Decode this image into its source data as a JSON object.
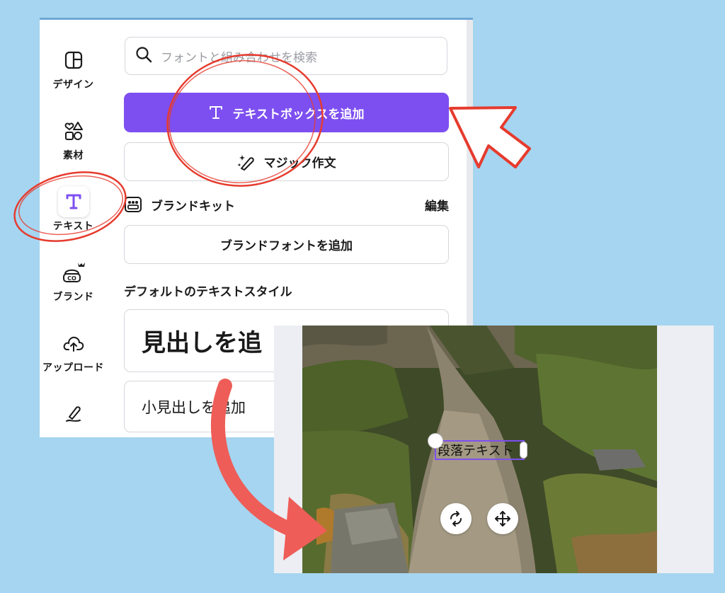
{
  "sidebar": {
    "items": [
      {
        "label": "デザイン",
        "icon": "layout-icon"
      },
      {
        "label": "素材",
        "icon": "shapes-icon"
      },
      {
        "label": "テキスト",
        "icon": "text-icon",
        "active": true
      },
      {
        "label": "ブランド",
        "icon": "brand-icon"
      },
      {
        "label": "アップロード",
        "icon": "upload-icon"
      },
      {
        "label": "",
        "icon": "draw-icon"
      }
    ]
  },
  "search": {
    "placeholder": "フォントと組み合わせを検索"
  },
  "buttons": {
    "add_textbox": "テキストボックスを追加",
    "magic_write": "マジック作文",
    "add_brand_font": "ブランドフォントを追加"
  },
  "brand_kit": {
    "title": "ブランドキット",
    "edit": "編集"
  },
  "default_styles": {
    "title": "デフォルトのテキストスタイル",
    "heading": "見出しを追",
    "subheading": "小見出しを追加"
  },
  "editor": {
    "textbox_text": "段落テキスト"
  },
  "colors": {
    "accent": "#7d4ff0",
    "annotation": "#e63b2e",
    "arrow": "#ee5d58",
    "background": "#a5d5f0"
  }
}
